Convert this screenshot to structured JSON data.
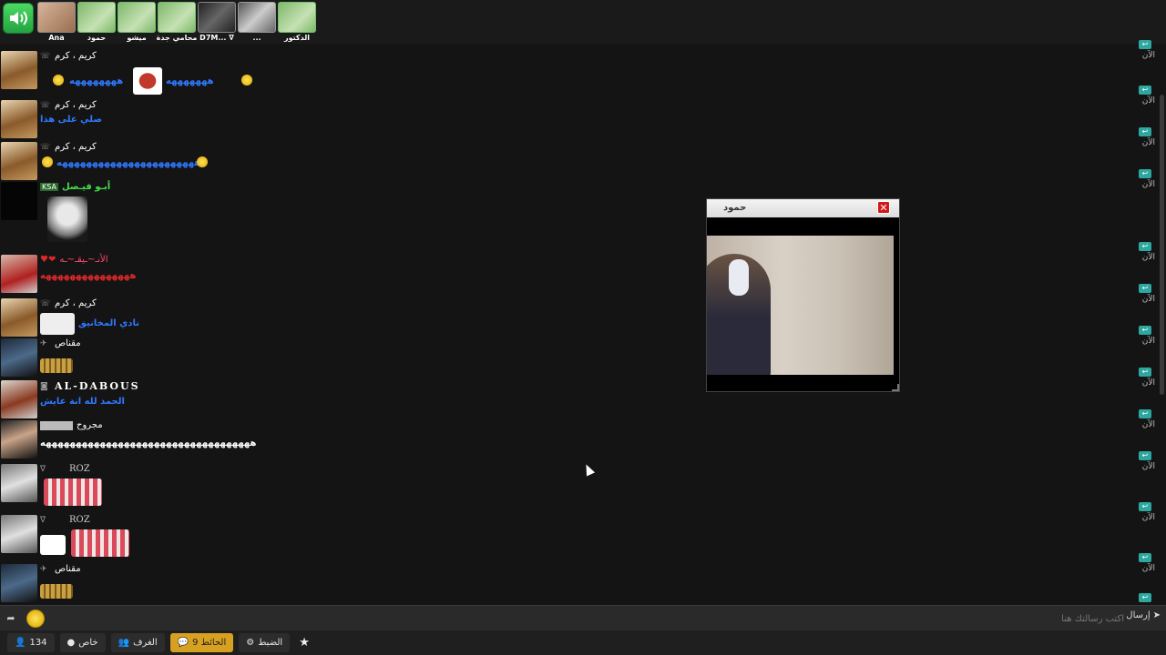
{
  "top_users": [
    {
      "name": "Ana",
      "style": "face"
    },
    {
      "name": "حمود",
      "style": "green"
    },
    {
      "name": "ميشو",
      "style": "green"
    },
    {
      "name": "محامي جدة",
      "style": "green"
    },
    {
      "name": "D7M... ∇",
      "style": "dark"
    },
    {
      "name": "...",
      "style": "grey"
    },
    {
      "name": "الدكتور",
      "style": "green"
    }
  ],
  "messages": [
    {
      "name": "كريم ، كرم",
      "text": "ههههههههه",
      "text2": "هههههههه"
    },
    {
      "name": "كريم ، كرم",
      "text": "صلي على هذا"
    },
    {
      "name": "كريم ، كرم",
      "text": "هههههههههههههههههههههههه"
    },
    {
      "name": "أبـو فيـصل",
      "badge": "KSA",
      "text": ""
    },
    {
      "name": "الأنـ~ـيقـ~ـه",
      "text": "هههههههههههههههه"
    },
    {
      "name": "كريم ، كرم",
      "text": "نادي المخانيق"
    },
    {
      "name": "مقناص",
      "text": ""
    },
    {
      "name": "AL-DABOUS",
      "text": "الحمد لله انة عايش"
    },
    {
      "name": "مجروح",
      "text": "هههههههههههههههههههههههههههههههههههه"
    },
    {
      "name": "ROZ",
      "text": ""
    },
    {
      "name": "ROZ",
      "text": ""
    },
    {
      "name": "مقناص",
      "text": ""
    }
  ],
  "time_label": "الآن",
  "video": {
    "title": "حمود"
  },
  "input": {
    "placeholder": "اكتب رسالتك هنا",
    "send_label": "إرسال"
  },
  "toolbar": {
    "users_count": "134",
    "private_label": "خاص",
    "rooms_label": "الغرف",
    "wall_label": "الحائط 9",
    "settings_label": "الضبط"
  },
  "colors": {
    "accent": "#d7a020",
    "reply": "#2ea7a0",
    "close": "#d21818"
  }
}
